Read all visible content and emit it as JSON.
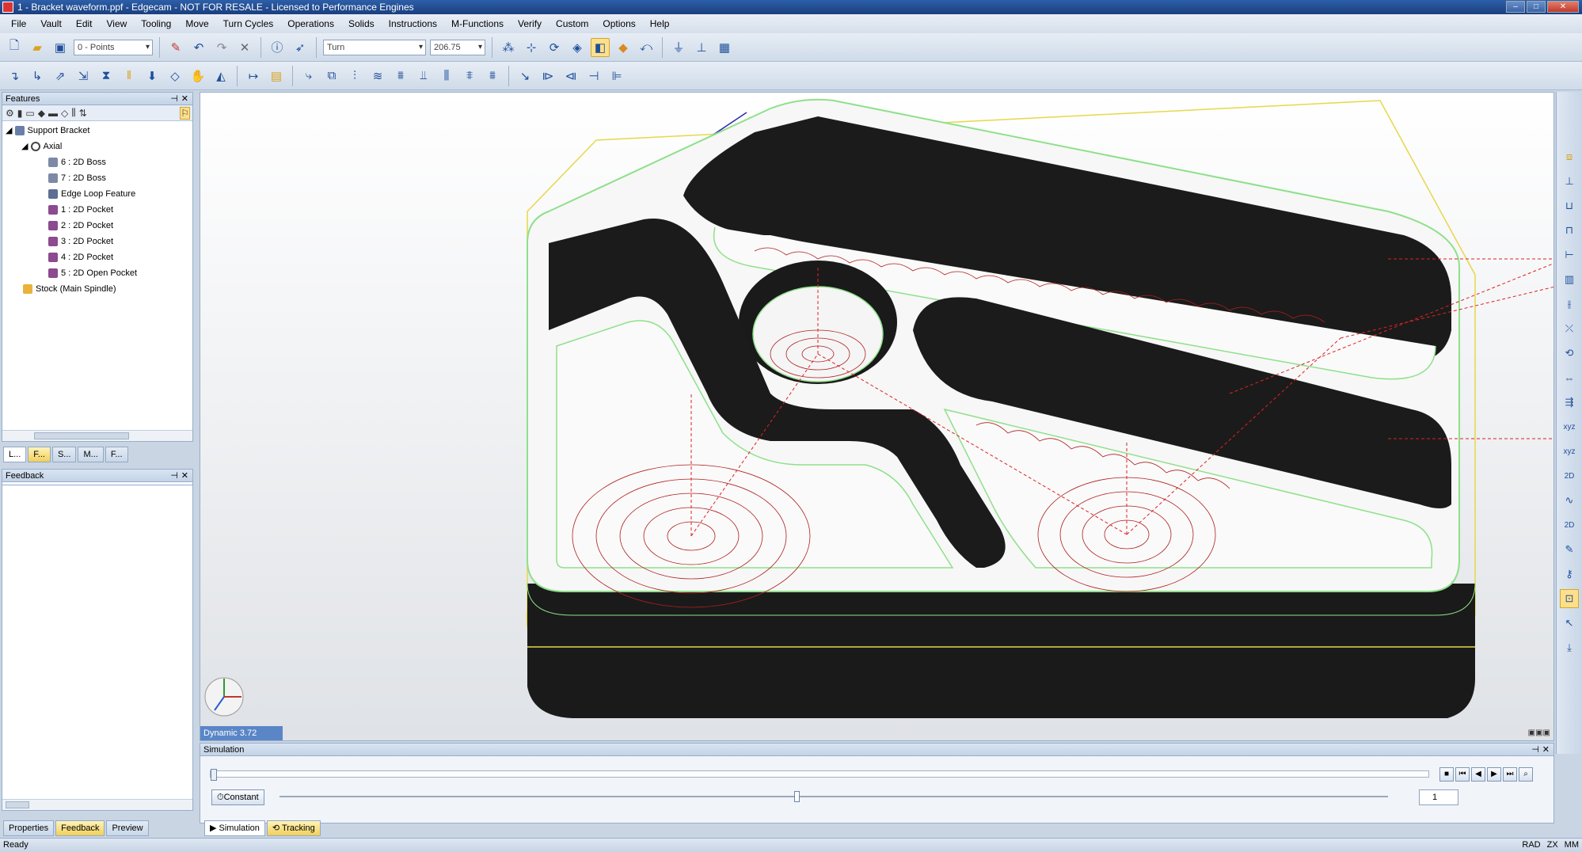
{
  "window": {
    "title": "1 - Bracket waveform.ppf - Edgecam - NOT FOR RESALE - Licensed to Performance Engines"
  },
  "menu": [
    "File",
    "Vault",
    "Edit",
    "View",
    "Tooling",
    "Move",
    "Turn Cycles",
    "Operations",
    "Solids",
    "Instructions",
    "M-Functions",
    "Verify",
    "Custom",
    "Options",
    "Help"
  ],
  "toolbar": {
    "layer_combo": "0 - Points",
    "turn_combo": "Turn",
    "value_combo": "206.75"
  },
  "features_panel": {
    "title": "Features",
    "tree": [
      {
        "label": "Support Bracket",
        "level": 0
      },
      {
        "label": "Axial",
        "level": 1
      },
      {
        "label": "6 : 2D Boss",
        "level": 2
      },
      {
        "label": "7 : 2D Boss",
        "level": 2
      },
      {
        "label": "Edge Loop Feature",
        "level": 2
      },
      {
        "label": "1 : 2D Pocket",
        "level": 2
      },
      {
        "label": "2 : 2D Pocket",
        "level": 2
      },
      {
        "label": "3 : 2D Pocket",
        "level": 2
      },
      {
        "label": "4 : 2D Pocket",
        "level": 2
      },
      {
        "label": "5 : 2D Open Pocket",
        "level": 2
      },
      {
        "label": "Stock (Main Spindle)",
        "level": 0
      }
    ],
    "tabs": [
      "L...",
      "F...",
      "S...",
      "M...",
      "F..."
    ]
  },
  "feedback_panel": {
    "title": "Feedback"
  },
  "left_bottom_tabs": [
    "Properties",
    "Feedback",
    "Preview"
  ],
  "viewport": {
    "dynamic_label": "Dynamic 3.72"
  },
  "simulation": {
    "title": "Simulation",
    "constant_label": "Constant",
    "step_value": "1"
  },
  "bottom_tabs": [
    "Simulation",
    "Tracking"
  ],
  "status": {
    "text": "Ready",
    "right_cells": [
      "RAD",
      "ZX",
      "MM"
    ]
  },
  "colors": {
    "stock_black": "#1a1a1a",
    "toolpath_red": "#b01d1d",
    "outline_green": "#8fe08a",
    "outline_yellow": "#e6d84a"
  }
}
